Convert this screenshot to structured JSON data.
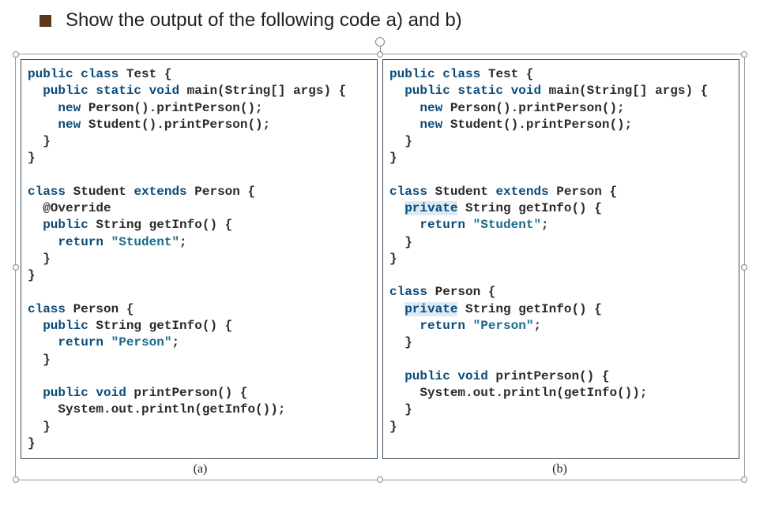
{
  "question": "Show the output of the following code a) and b)",
  "labels": {
    "a": "(a)",
    "b": "(b)"
  },
  "codeA": {
    "l1_kw1": "public",
    "l1_kw2": "class",
    "l1_name": " Test {",
    "l2_pad": "  ",
    "l2_kw1": "public",
    "l2_kw2": "static",
    "l2_kw3": "void",
    "l2_rest": " main(String[] args) {",
    "l3_pad": "    ",
    "l3_kw": "new",
    "l3_rest": " Person().printPerson();",
    "l4_pad": "    ",
    "l4_kw": "new",
    "l4_rest": " Student().printPerson();",
    "l5": "  }",
    "l6": "}",
    "l7": "",
    "l8_kw": "class",
    "l8_mid": " Student ",
    "l8_kw2": "extends",
    "l8_rest": " Person {",
    "l9": "  @Override",
    "l10_pad": "  ",
    "l10_kw": "public",
    "l10_rest": " String getInfo() {",
    "l11_pad": "    ",
    "l11_kw": "return",
    "l11_sp": " ",
    "l11_str": "\"Student\"",
    "l11_end": ";",
    "l12": "  }",
    "l13": "}",
    "l14": "",
    "l15_kw": "class",
    "l15_rest": " Person {",
    "l16_pad": "  ",
    "l16_kw": "public",
    "l16_rest": " String getInfo() {",
    "l17_pad": "    ",
    "l17_kw": "return",
    "l17_sp": " ",
    "l17_str": "\"Person\"",
    "l17_end": ";",
    "l18": "  }",
    "l19": "",
    "l20_pad": "  ",
    "l20_kw1": "public",
    "l20_kw2": "void",
    "l20_rest": " printPerson() {",
    "l21": "    System.out.println(getInfo());",
    "l22": "  }",
    "l23": "}"
  },
  "codeB": {
    "l1_kw1": "public",
    "l1_kw2": "class",
    "l1_name": " Test {",
    "l2_pad": "  ",
    "l2_kw1": "public",
    "l2_kw2": "static",
    "l2_kw3": "void",
    "l2_rest": " main(String[] args) {",
    "l3_pad": "    ",
    "l3_kw": "new",
    "l3_rest": " Person().printPerson();",
    "l4_pad": "    ",
    "l4_kw": "new",
    "l4_rest": " Student().printPerson();",
    "l5": "  }",
    "l6": "}",
    "l7": "",
    "l8_kw": "class",
    "l8_mid": " Student ",
    "l8_kw2": "extends",
    "l8_rest": " Person {",
    "l9_pad": "  ",
    "l9_kw": "private",
    "l9_rest": " String getInfo() {",
    "l10_pad": "    ",
    "l10_kw": "return",
    "l10_sp": " ",
    "l10_str": "\"Student\"",
    "l10_end": ";",
    "l11": "  }",
    "l12": "}",
    "l13": "",
    "l14_kw": "class",
    "l14_rest": " Person {",
    "l15_pad": "  ",
    "l15_kw": "private",
    "l15_rest": " String getInfo() {",
    "l16_pad": "    ",
    "l16_kw": "return",
    "l16_sp": " ",
    "l16_str": "\"Person\"",
    "l16_end": ";",
    "l17": "  }",
    "l18": "",
    "l19_pad": "  ",
    "l19_kw1": "public",
    "l19_kw2": "void",
    "l19_rest": " printPerson() {",
    "l20": "    System.out.println(getInfo());",
    "l21": "  }",
    "l22": "}"
  }
}
